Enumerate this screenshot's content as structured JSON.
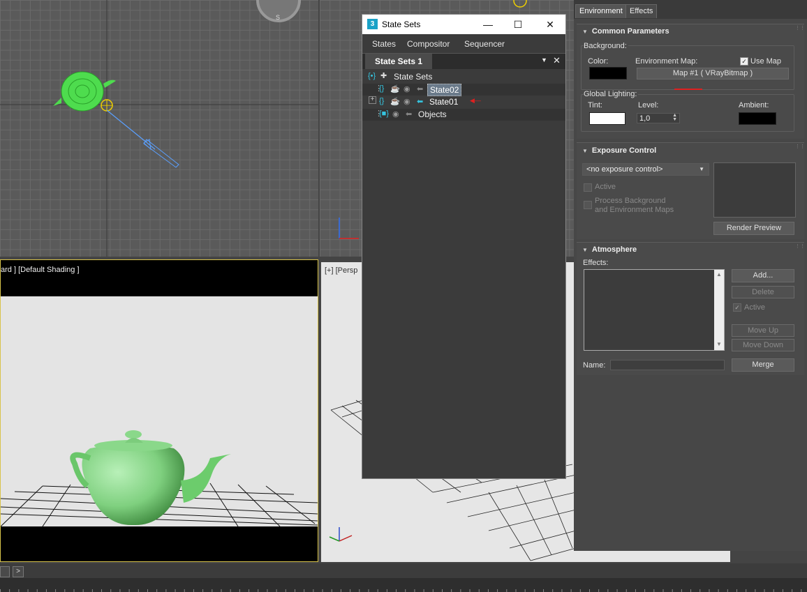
{
  "viewports": {
    "camera_label": "ard ] [Default Shading ]",
    "persp_label": "[+] [Persp"
  },
  "state_sets": {
    "window_title": "State Sets",
    "app_icon": "3",
    "menu": {
      "states": "States",
      "compositor": "Compositor",
      "sequencer": "Sequencer"
    },
    "tab_label": "State Sets 1",
    "tree": {
      "root": "State Sets",
      "state02": "State02",
      "state01": "State01",
      "objects": "Objects"
    }
  },
  "environment_panel": {
    "tabs": {
      "environment": "Environment",
      "effects": "Effects"
    },
    "common": {
      "title": "Common Parameters",
      "background_label": "Background:",
      "color_label": "Color:",
      "envmap_label": "Environment Map:",
      "use_map_label": "Use Map",
      "use_map_checked": true,
      "map_button": "Map #1 ( VRayBitmap )",
      "global_lighting_label": "Global Lighting:",
      "tint_label": "Tint:",
      "level_label": "Level:",
      "level_value": "1,0",
      "ambient_label": "Ambient:",
      "bg_color": "#000000",
      "tint_color": "#ffffff",
      "ambient_color": "#000000"
    },
    "exposure": {
      "title": "Exposure Control",
      "dropdown_value": "<no exposure control>",
      "active_label": "Active",
      "process_bg_label_1": "Process Background",
      "process_bg_label_2": "and Environment Maps",
      "render_preview": "Render Preview"
    },
    "atmosphere": {
      "title": "Atmosphere",
      "effects_label": "Effects:",
      "add": "Add...",
      "delete": "Delete",
      "active": "Active",
      "move_up": "Move Up",
      "move_down": "Move Down",
      "name_label": "Name:",
      "merge": "Merge"
    }
  },
  "bottom": {
    "next_arrow": ">"
  }
}
